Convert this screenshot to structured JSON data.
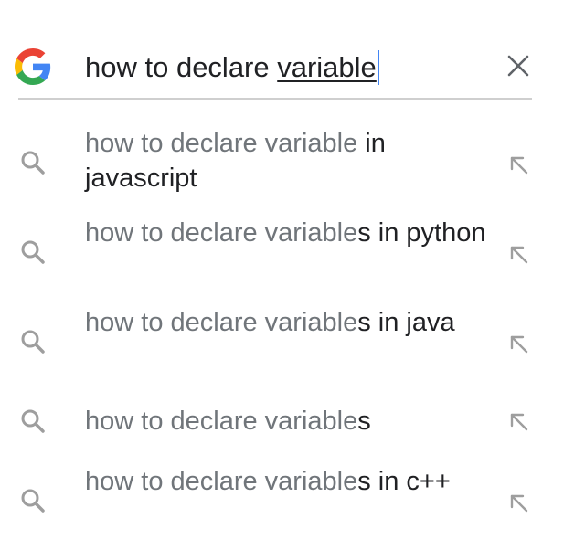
{
  "search": {
    "query_underlined": "how to declare variable",
    "query_prefix": "how to declare ",
    "query_word": "variable",
    "logo_icon": "google-g-icon",
    "clear_icon": "close-icon"
  },
  "suggestions": [
    {
      "match": "how to declare variable",
      "completion": " in javascript",
      "search_icon": "search-icon",
      "fill_icon": "arrow-up-left-icon"
    },
    {
      "match": "how to declare variable",
      "completion": "s in python",
      "search_icon": "search-icon",
      "fill_icon": "arrow-up-left-icon"
    },
    {
      "match": "how to declare variable",
      "completion": "s in java",
      "search_icon": "search-icon",
      "fill_icon": "arrow-up-left-icon"
    },
    {
      "match": "how to declare variable",
      "completion": "s",
      "search_icon": "search-icon",
      "fill_icon": "arrow-up-left-icon"
    },
    {
      "match": "how to declare variable",
      "completion": "s in c++",
      "search_icon": "search-icon",
      "fill_icon": "arrow-up-left-icon"
    }
  ],
  "colors": {
    "caret": "#4285f4",
    "match_text": "#70757a",
    "completion_text": "#202124",
    "divider": "#cfcfcf",
    "icon_gray": "#9e9e9e"
  }
}
